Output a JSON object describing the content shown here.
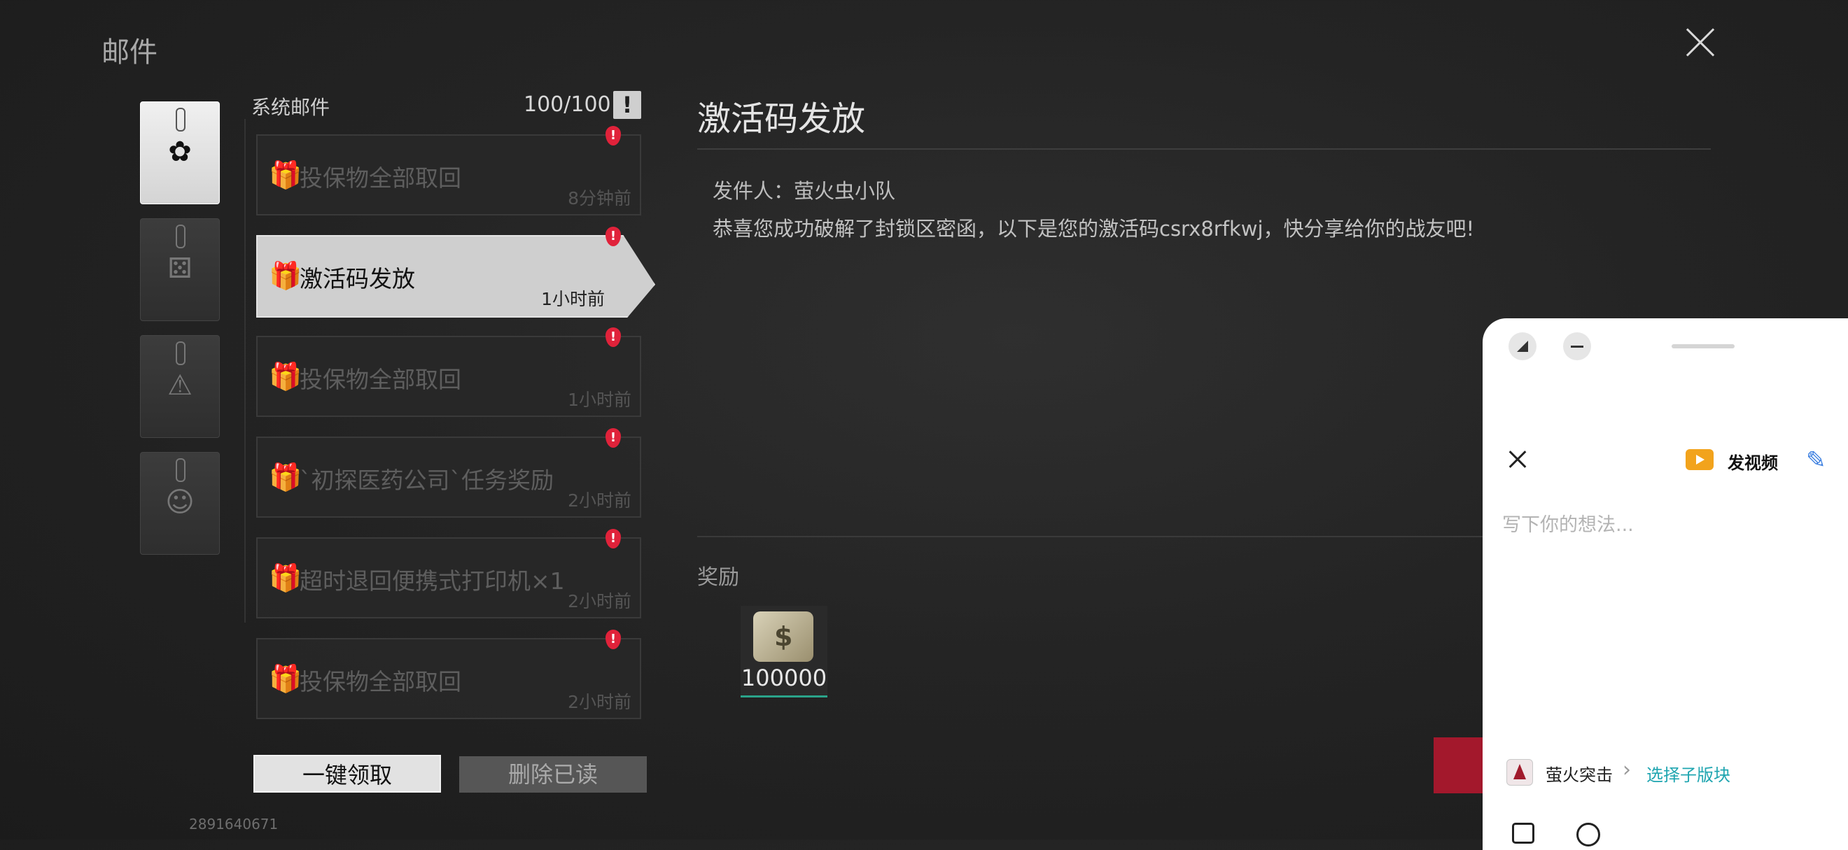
{
  "header": {
    "title": "邮件"
  },
  "categories": [
    {
      "name": "system",
      "glyph": "✿",
      "active": true
    },
    {
      "name": "friends",
      "glyph": "⚄",
      "active": false
    },
    {
      "name": "warning",
      "glyph": "⚠",
      "active": false
    },
    {
      "name": "character",
      "glyph": "☺",
      "active": false
    }
  ],
  "mail_list": {
    "title": "系统邮件",
    "count": "100/100",
    "warn_glyph": "!",
    "items": [
      {
        "subject": "投保物全部取回",
        "time": "8分钟前",
        "active": false
      },
      {
        "subject": "激活码发放",
        "time": "1小时前",
        "active": true
      },
      {
        "subject": "投保物全部取回",
        "time": "1小时前",
        "active": false
      },
      {
        "subject": "`初探医药公司`任务奖励",
        "time": "2小时前",
        "active": false
      },
      {
        "subject": "超时退回便携式打印机×1",
        "time": "2小时前",
        "active": false
      },
      {
        "subject": "投保物全部取回",
        "time": "2小时前",
        "active": false
      }
    ],
    "badge_glyph": "!",
    "gift_glyph": "🎁"
  },
  "buttons": {
    "claim_all": "一键领取",
    "delete_read": "删除已读"
  },
  "uid": "2891640671",
  "detail": {
    "title": "激活码发放",
    "sender": "发件人：萤火虫小队",
    "body": "恭喜您成功破解了封锁区密函，以下是您的激活码csrx8rfkwj，快分享给你的战友吧!",
    "reward_label": "奖励",
    "reward_qty": "100000"
  },
  "compose_panel": {
    "video_label": "发视频",
    "placeholder": "写下你的想法...",
    "pen_glyph": "✎",
    "community": "萤火突击",
    "chevron": "›",
    "sub_forum": "选择子版块"
  },
  "colors": {
    "badge": "#e0223a",
    "accent_link": "#1fa5b0",
    "video": "#f2a31c",
    "reward_bar": "#2aa38a"
  }
}
